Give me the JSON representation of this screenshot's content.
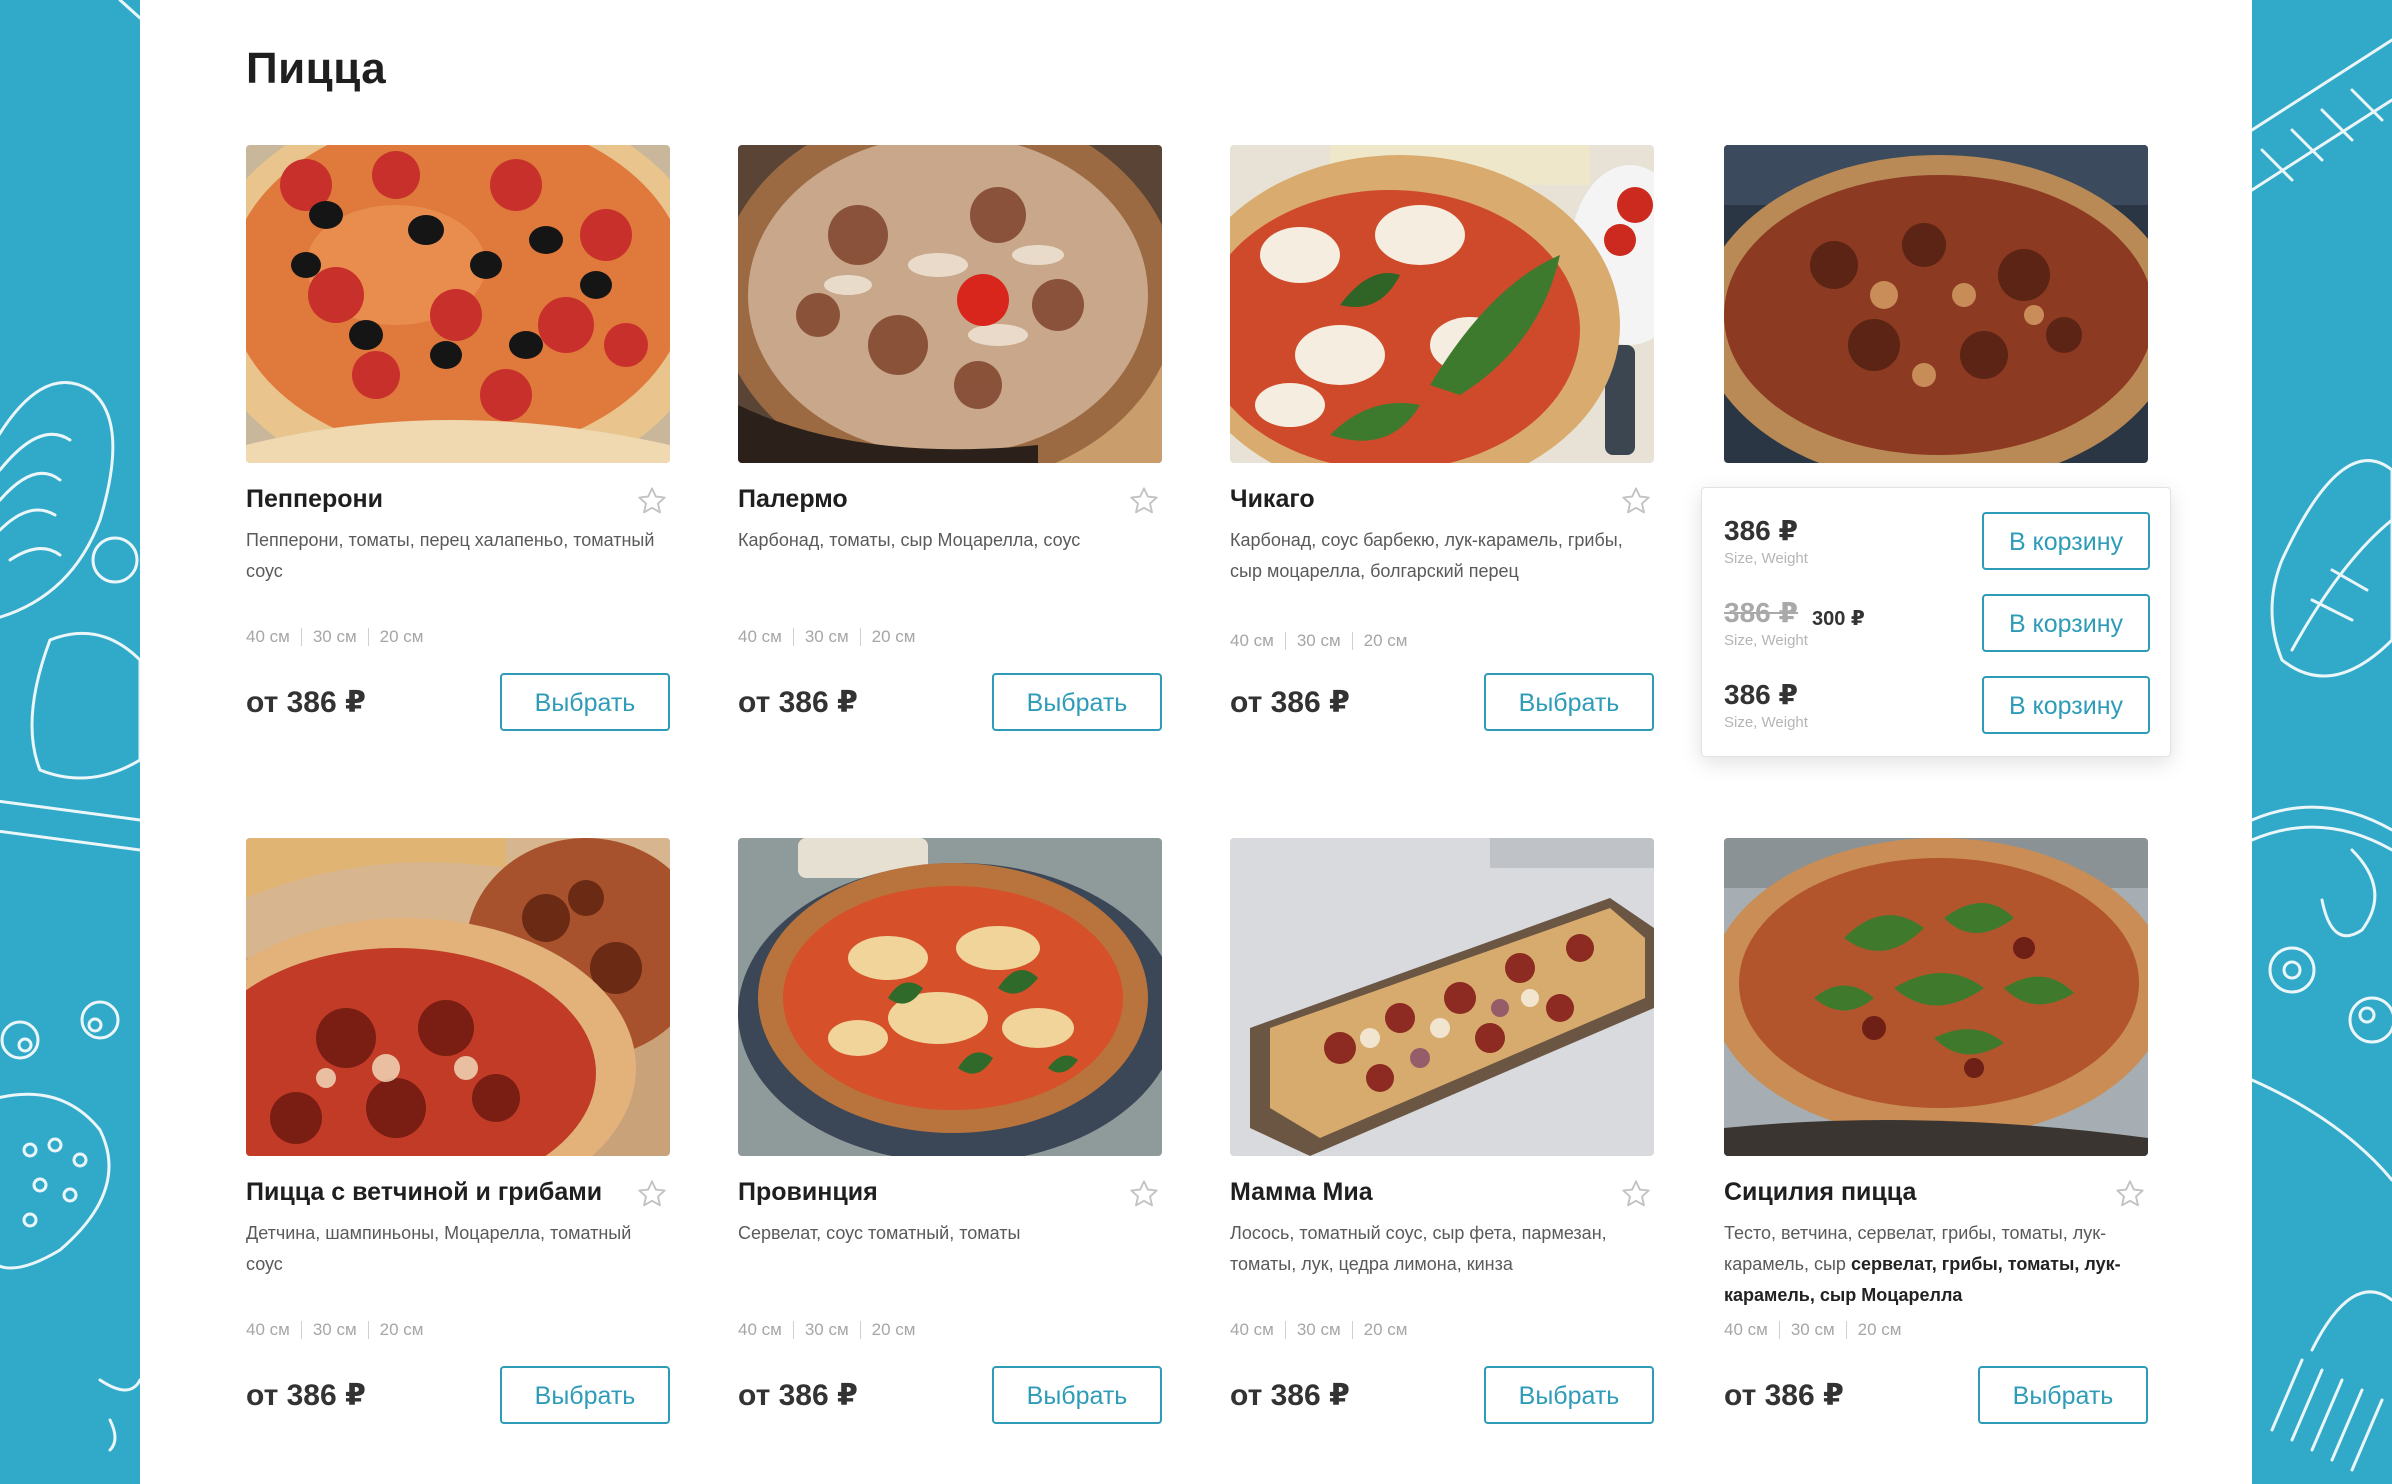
{
  "colors": {
    "accent": "#2e9cb8",
    "background": "#31a9c8",
    "text": "#1f1f1f"
  },
  "section_title": "Пицца",
  "products": [
    {
      "name": "Пепперони",
      "description": "Пепперони, томаты, перец халапеньо, томатный соус",
      "sizes": [
        "40 см",
        "30 см",
        "20 см"
      ],
      "price": "от 386 ₽",
      "button": "Выбрать",
      "favorite_icon": "star-outline-icon"
    },
    {
      "name": "Палермо",
      "description": "Карбонад, томаты, сыр Моцарелла, соус",
      "sizes": [
        "40 см",
        "30 см",
        "20 см"
      ],
      "price": "от 386 ₽",
      "button": "Выбрать",
      "favorite_icon": "star-outline-icon"
    },
    {
      "name": "Чикаго",
      "description": "Карбонад, соус барбекю, лук-карамель, грибы, сыр моцарелла, болгарский перец",
      "sizes": [
        "40 см",
        "30 см",
        "20 см"
      ],
      "price": "от 386 ₽",
      "button": "Выбрать",
      "favorite_icon": "star-outline-icon"
    },
    {
      "name": "Пицца с ветчиной и грибами",
      "description": "Детчина, шампиньоны, Моцарелла, томатный соус",
      "sizes": [
        "40 см",
        "30 см",
        "20 см"
      ],
      "price": "от 386 ₽",
      "button": "Выбрать",
      "favorite_icon": "star-outline-icon"
    },
    {
      "name": "Провинция",
      "description": "Сервелат, соус томатный, томаты",
      "sizes": [
        "40 см",
        "30 см",
        "20 см"
      ],
      "price": "от 386 ₽",
      "button": "Выбрать",
      "favorite_icon": "star-outline-icon"
    },
    {
      "name": "Мамма Миа",
      "description": "Лосось, томатный соус, сыр фета, пармезан, томаты, лук, цедра лимона, кинза",
      "sizes": [
        "40 см",
        "30 см",
        "20 см"
      ],
      "price": "от 386 ₽",
      "button": "Выбрать",
      "favorite_icon": "star-outline-icon"
    },
    {
      "name": "Сицилия пицца",
      "description_plain": "Тесто, ветчина, сервелат, грибы, томаты, лук-карамель, сыр ",
      "description_bold": "сервелат, грибы, томаты, лук-карамель, сыр Моцарелла",
      "sizes": [
        "40 см",
        "30 см",
        "20 см"
      ],
      "price": "от 386 ₽",
      "button": "Выбрать",
      "favorite_icon": "star-outline-icon"
    }
  ],
  "size_popup": {
    "options": [
      {
        "price": "386 ₽",
        "meta": "Size, Weight",
        "button": "В корзину"
      },
      {
        "old_price": "386 ₽",
        "new_price": "300 ₽",
        "meta": "Size, Weight",
        "button": "В корзину"
      },
      {
        "price": "386 ₽",
        "meta": "Size, Weight",
        "button": "В корзину"
      }
    ]
  }
}
